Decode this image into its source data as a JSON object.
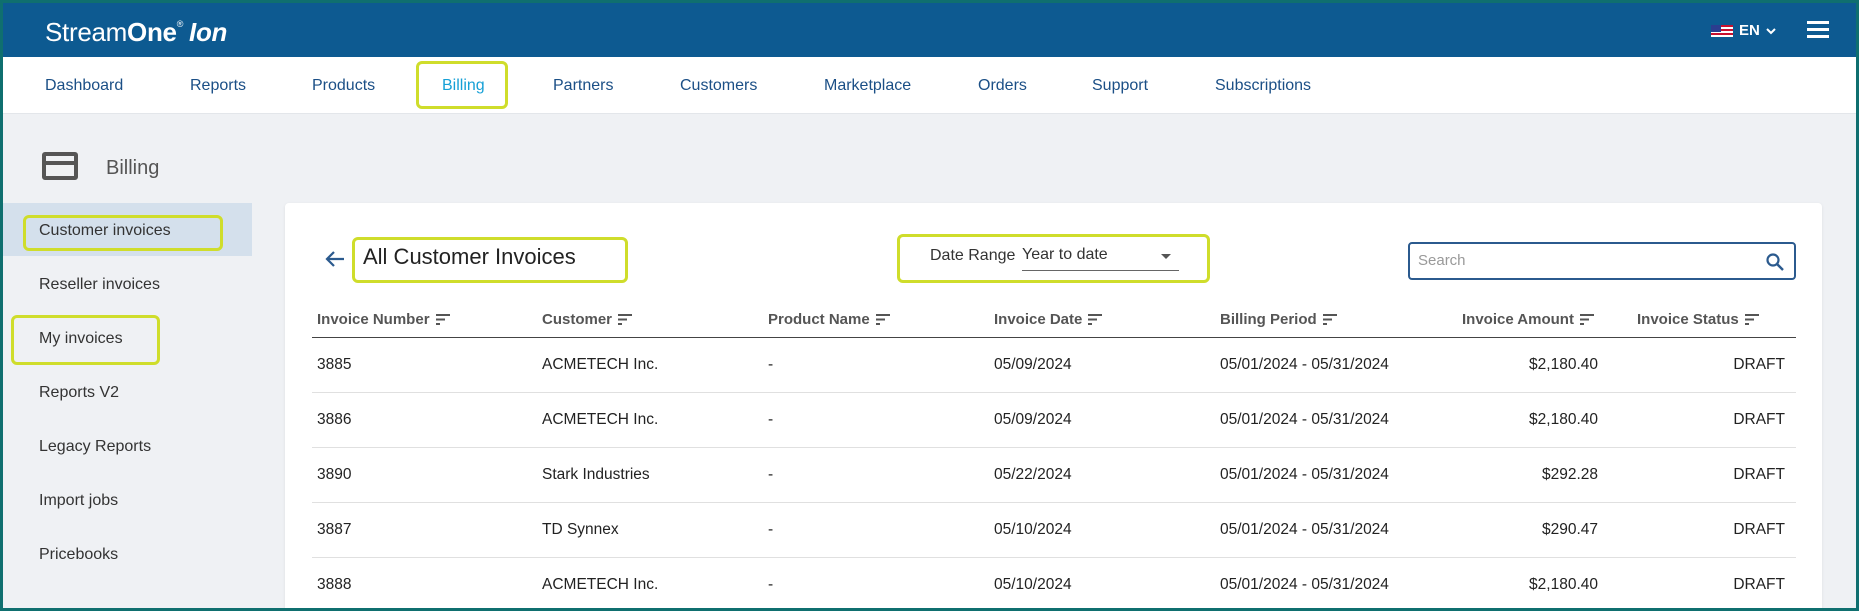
{
  "brand": {
    "part1": "Stream",
    "part2": "One",
    "reg": "®",
    "part3": "Ion"
  },
  "lang": {
    "code": "EN"
  },
  "nav": [
    {
      "label": "Dashboard"
    },
    {
      "label": "Reports"
    },
    {
      "label": "Products"
    },
    {
      "label": "Billing"
    },
    {
      "label": "Partners"
    },
    {
      "label": "Customers"
    },
    {
      "label": "Marketplace"
    },
    {
      "label": "Orders"
    },
    {
      "label": "Support"
    },
    {
      "label": "Subscriptions"
    }
  ],
  "sidebar": {
    "title": "Billing",
    "items": [
      {
        "label": "Customer invoices"
      },
      {
        "label": "Reseller invoices"
      },
      {
        "label": "My invoices"
      },
      {
        "label": "Reports V2"
      },
      {
        "label": "Legacy Reports"
      },
      {
        "label": "Import jobs"
      },
      {
        "label": "Pricebooks"
      }
    ]
  },
  "main": {
    "title": "All Customer Invoices",
    "date_range_label": "Date Range",
    "date_range_value": "Year to date",
    "search_placeholder": "Search"
  },
  "table": {
    "columns": [
      "Invoice Number",
      "Customer",
      "Product Name",
      "Invoice Date",
      "Billing Period",
      "Invoice Amount",
      "Invoice Status"
    ],
    "rows": [
      [
        "3885",
        "ACMETECH Inc.",
        "-",
        "05/09/2024",
        "05/01/2024 - 05/31/2024",
        "$2,180.40",
        "DRAFT"
      ],
      [
        "3886",
        "ACMETECH Inc.",
        "-",
        "05/09/2024",
        "05/01/2024 - 05/31/2024",
        "$2,180.40",
        "DRAFT"
      ],
      [
        "3890",
        "Stark Industries",
        "-",
        "05/22/2024",
        "05/01/2024 - 05/31/2024",
        "$292.28",
        "DRAFT"
      ],
      [
        "3887",
        "TD Synnex",
        "-",
        "05/10/2024",
        "05/01/2024 - 05/31/2024",
        "$290.47",
        "DRAFT"
      ],
      [
        "3888",
        "ACMETECH Inc.",
        "-",
        "05/10/2024",
        "05/01/2024 - 05/31/2024",
        "$2,180.40",
        "DRAFT"
      ]
    ]
  },
  "colors": {
    "header": "#0d5a91",
    "nav_text": "#1b4f86",
    "active_nav": "#16a0d6",
    "highlight": "#cfdd2b"
  }
}
